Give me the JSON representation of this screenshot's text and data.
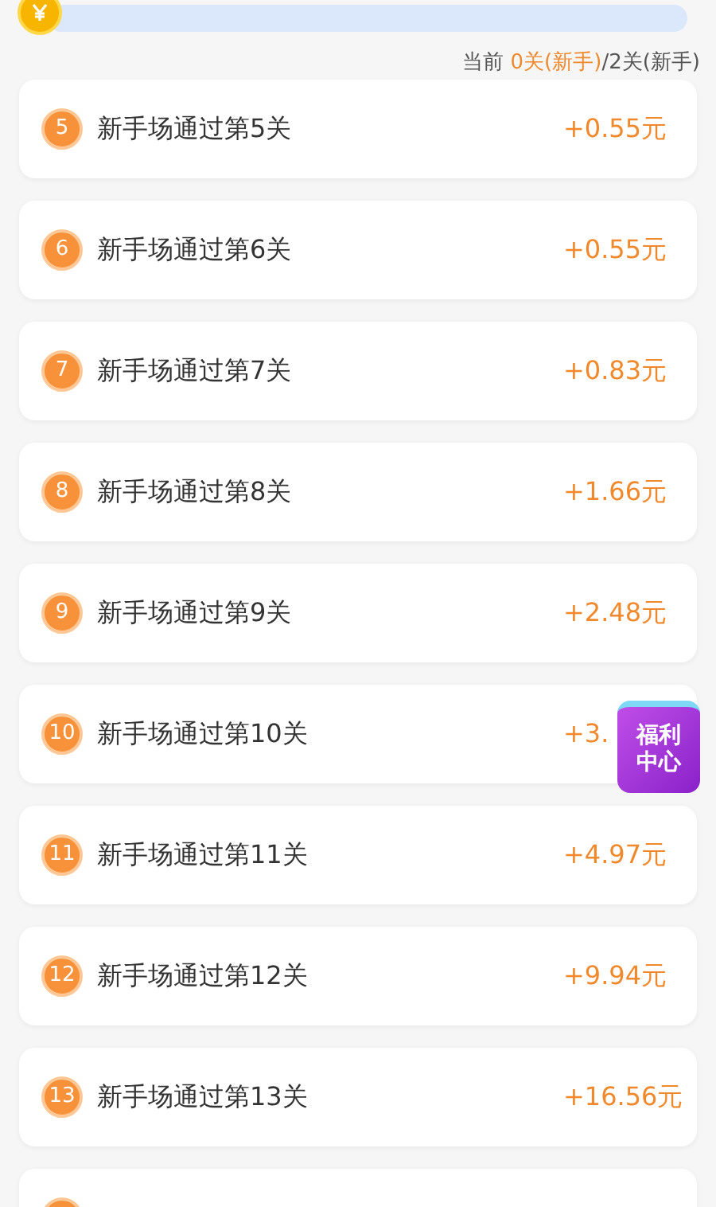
{
  "status": {
    "label": "当前 ",
    "current": "0关(新手)",
    "total": "/2关(新手)"
  },
  "rows": [
    {
      "number": "5",
      "title": "新手场通过第5关",
      "reward": "+0.55元"
    },
    {
      "number": "6",
      "title": "新手场通过第6关",
      "reward": "+0.55元"
    },
    {
      "number": "7",
      "title": "新手场通过第7关",
      "reward": "+0.83元"
    },
    {
      "number": "8",
      "title": "新手场通过第8关",
      "reward": "+1.66元"
    },
    {
      "number": "9",
      "title": "新手场通过第9关",
      "reward": "+2.48元"
    },
    {
      "number": "10",
      "title": "新手场通过第10关",
      "reward": "+3."
    },
    {
      "number": "11",
      "title": "新手场通过第11关",
      "reward": "+4.97元"
    },
    {
      "number": "12",
      "title": "新手场通过第12关",
      "reward": "+9.94元"
    },
    {
      "number": "13",
      "title": "新手场通过第13关",
      "reward": "+16.56元"
    }
  ],
  "floating_badge": {
    "label": "福利中心"
  }
}
